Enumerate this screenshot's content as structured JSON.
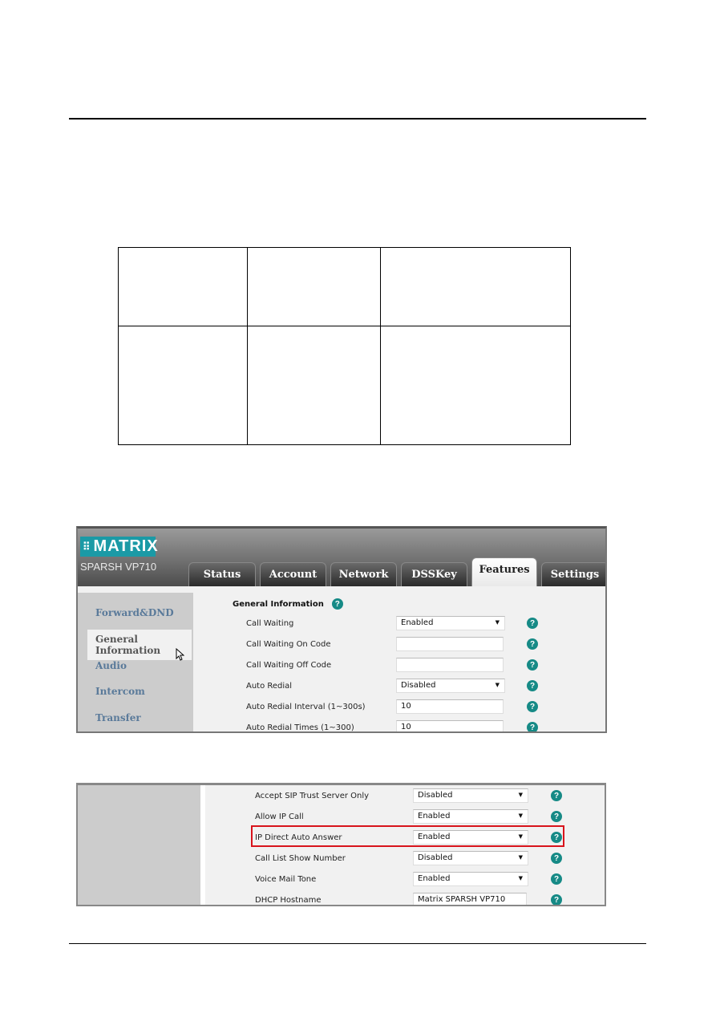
{
  "document": {
    "table": {
      "rows": [
        [
          "",
          "",
          ""
        ],
        [
          "",
          "",
          ""
        ]
      ]
    }
  },
  "screenshot1": {
    "logo": {
      "brand": "MATRIX",
      "mark": "⠿"
    },
    "model": "SPARSH VP710",
    "tabs": [
      {
        "label": "Status",
        "active": false
      },
      {
        "label": "Account",
        "active": false
      },
      {
        "label": "Network",
        "active": false
      },
      {
        "label": "DSSKey",
        "active": false
      },
      {
        "label": "Features",
        "active": true
      },
      {
        "label": "Settings",
        "active": false
      }
    ],
    "sidebar": [
      {
        "label": "Forward&DND",
        "active": false
      },
      {
        "label": "General Information",
        "active": true
      },
      {
        "label": "Audio",
        "active": false
      },
      {
        "label": "Intercom",
        "active": false
      },
      {
        "label": "Transfer",
        "active": false
      }
    ],
    "section_title": "General Information",
    "help_glyph": "?",
    "dropdown_arrow": "▼",
    "fields": [
      {
        "label": "Call Waiting",
        "type": "select",
        "value": "Enabled"
      },
      {
        "label": "Call Waiting On Code",
        "type": "input",
        "value": ""
      },
      {
        "label": "Call Waiting Off Code",
        "type": "input",
        "value": ""
      },
      {
        "label": "Auto Redial",
        "type": "select",
        "value": "Disabled"
      },
      {
        "label": "Auto Redial Interval (1~300s)",
        "type": "input",
        "value": "10"
      },
      {
        "label": "Auto Redial Times (1~300)",
        "type": "input",
        "value": "10"
      }
    ]
  },
  "screenshot2": {
    "fields": [
      {
        "label": "Accept SIP Trust Server Only",
        "type": "select",
        "value": "Disabled"
      },
      {
        "label": "Allow IP Call",
        "type": "select",
        "value": "Enabled"
      },
      {
        "label": "IP Direct Auto Answer",
        "type": "select",
        "value": "Enabled",
        "highlighted": true
      },
      {
        "label": "Call List Show Number",
        "type": "select",
        "value": "Disabled"
      },
      {
        "label": "Voice Mail Tone",
        "type": "select",
        "value": "Enabled"
      },
      {
        "label": "DHCP Hostname",
        "type": "input",
        "value": "Matrix SPARSH VP710"
      }
    ],
    "highlight_color": "#d8141c"
  }
}
